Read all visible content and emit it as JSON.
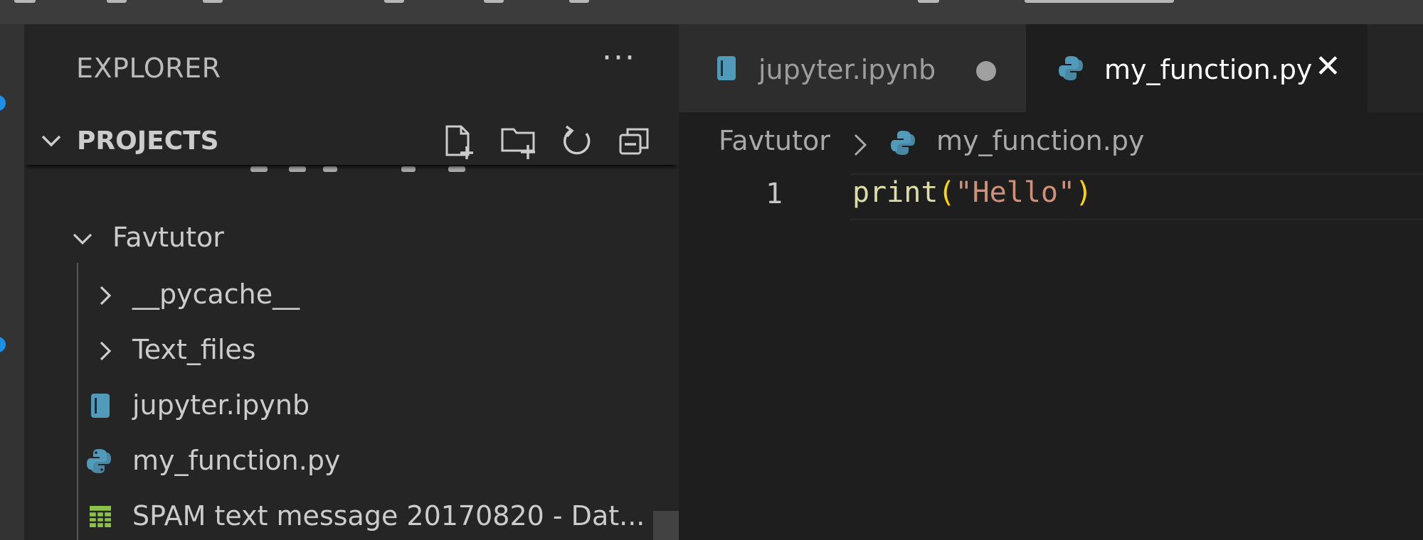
{
  "sidebar": {
    "title": "EXPLORER",
    "more_glyph": "···",
    "section_label": "PROJECTS",
    "tree": [
      {
        "label": "Favtutor"
      },
      {
        "label": "__pycache__"
      },
      {
        "label": "Text_files"
      },
      {
        "label": "jupyter.ipynb"
      },
      {
        "label": "my_function.py"
      },
      {
        "label": "SPAM text message 20170820 - Dat..."
      }
    ]
  },
  "tabs": [
    {
      "label": "jupyter.ipynb",
      "modified": true
    },
    {
      "label": "my_function.py",
      "active": true,
      "close_glyph": "✕"
    }
  ],
  "breadcrumb": {
    "folder": "Favtutor",
    "file": "my_function.py"
  },
  "editor": {
    "line_number": "1",
    "code": {
      "fn": "print",
      "open_paren": "(",
      "string": "\"Hello\"",
      "close_paren": ")"
    }
  },
  "colors": {
    "python_icon": "#519aba",
    "notebook_icon": "#519aba",
    "csv_icon": "#8bc34a",
    "string": "#ce9178",
    "paren": "#ffd700",
    "function": "#dcdcaa"
  }
}
